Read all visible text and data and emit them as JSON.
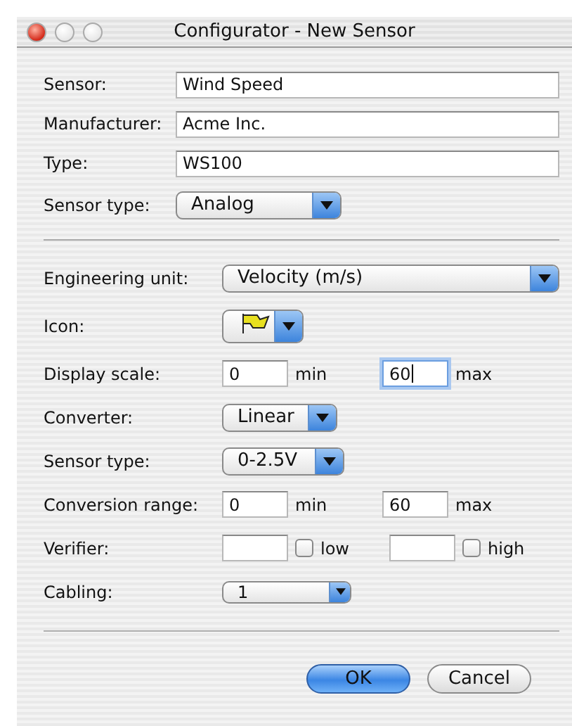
{
  "window": {
    "title": "Configurator - New Sensor",
    "controls": [
      {
        "kind": "close",
        "enabled": true
      },
      {
        "kind": "minimize",
        "enabled": false
      },
      {
        "kind": "zoom",
        "enabled": false
      }
    ]
  },
  "general": [
    {
      "kind": "text",
      "label": "Sensor:",
      "value": "Wind Speed"
    },
    {
      "kind": "text",
      "label": "Manufacturer:",
      "value": "Acme Inc."
    },
    {
      "kind": "text",
      "label": "Type:",
      "value": "WS100"
    },
    {
      "kind": "popup",
      "label": "Sensor type:",
      "value": "Analog"
    }
  ],
  "details": [
    {
      "kind": "wide_popup",
      "label": "Engineering unit:",
      "value": "Velocity (m/s)"
    },
    {
      "kind": "icon_popup",
      "label": "Icon:"
    },
    {
      "kind": "range",
      "label": "Display scale:",
      "fields": [
        {
          "value": "0",
          "unit": "min",
          "focused": false
        },
        {
          "value": "60",
          "unit": "max",
          "focused": true
        }
      ]
    },
    {
      "kind": "popup",
      "label": "Converter:",
      "value": "Linear"
    },
    {
      "kind": "popup",
      "label": "Sensor type:",
      "value": "0-2.5V"
    },
    {
      "kind": "range",
      "label": "Conversion range:",
      "fields": [
        {
          "value": "0",
          "unit": "min",
          "focused": false
        },
        {
          "value": "60",
          "unit": "max",
          "focused": false
        }
      ]
    },
    {
      "kind": "verifier",
      "label": "Verifier:",
      "checks": [
        {
          "label": "low",
          "checked": false
        },
        {
          "label": "high",
          "checked": false
        }
      ]
    },
    {
      "kind": "small_popup",
      "label": "Cabling:",
      "value": "1"
    }
  ],
  "buttons": [
    {
      "label": "OK",
      "default": true
    },
    {
      "label": "Cancel",
      "default": false
    }
  ]
}
